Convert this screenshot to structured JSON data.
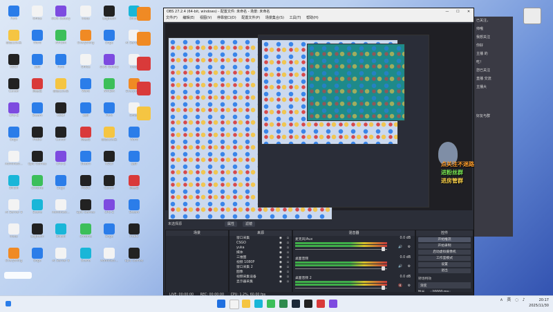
{
  "desktop": {
    "icons": [
      {
        "label": "Fork",
        "color": "tile-blue"
      },
      {
        "label": "新建文件夹",
        "color": "tile-folder"
      },
      {
        "label": "KODI",
        "color": "tile-dark"
      },
      {
        "label": "Cursor",
        "color": "tile-dark"
      },
      {
        "label": "CPU-Z",
        "color": "tile-purple"
      },
      {
        "label": "Edge",
        "color": "tile-blue"
      },
      {
        "label": "Administr...",
        "color": "tile-white"
      },
      {
        "label": "Bilibili",
        "color": "tile-cyan"
      },
      {
        "label": "AI Server 8",
        "color": "tile-white"
      },
      {
        "label": "Insta",
        "color": "tile-white"
      },
      {
        "label": "Everything",
        "color": "tile-orange"
      },
      {
        "label": "Office",
        "color": "tile-white"
      },
      {
        "label": "Word",
        "color": "tile-blue"
      },
      {
        "label": "录屏",
        "color": "tile-blue"
      },
      {
        "label": "网易云",
        "color": "tile-red"
      },
      {
        "label": "Steam",
        "color": "tile-blue"
      },
      {
        "label": "PUBG",
        "color": "tile-dark"
      },
      {
        "label": "Epic Games",
        "color": "tile-dark"
      },
      {
        "label": "Chrome",
        "color": "tile-green"
      },
      {
        "label": "Scene",
        "color": "tile-cyan"
      },
      {
        "label": "Logitech",
        "color": "tile-dark"
      },
      {
        "label": "Edge",
        "color": "tile-blue"
      },
      {
        "label": "GOG Galaxy",
        "color": "tile-purple"
      },
      {
        "label": "NVIDIA",
        "color": "tile-green"
      }
    ]
  },
  "obs": {
    "title": "OBS 27.2.4 (64-bit, windows) - 配置文件: 未命名 - 场景: 未命名",
    "menu": [
      "文件(F)",
      "编辑(E)",
      "视图(V)",
      "停靠窗口(D)",
      "配置文件(P)",
      "场景集合(S)",
      "工具(T)",
      "帮助(H)"
    ],
    "window_controls": {
      "minimize": "—",
      "maximize": "☐",
      "close": "✕"
    },
    "scene_bar": {
      "current": "未选择源",
      "properties": "属性",
      "filters": "滤镜"
    },
    "docks": {
      "scenes": {
        "title": "场景",
        "items": []
      },
      "sources": {
        "title": "来源",
        "items": [
          "窗口采集",
          "CSGO",
          "yuka",
          "媒体",
          "三维图",
          "视频 1080P",
          "窗口采集 2",
          "图像",
          "视频采集设备",
          "显示器采集"
        ]
      },
      "mixer": {
        "title": "混音器",
        "channels": [
          {
            "name": "麦克风/Aux",
            "db": "0.0 dB"
          },
          {
            "name": "桌面音频",
            "db": "0.0 dB"
          },
          {
            "name": "桌面音频 2",
            "db": "0.0 dB"
          }
        ]
      },
      "transitions": {
        "title": "转场特效",
        "type": "渐变",
        "duration_label": "时长",
        "duration": "20000 ms"
      },
      "controls": {
        "title": "控件",
        "buttons": [
          "开始推流",
          "开始录制",
          "启动虚拟摄像机",
          "工作室模式",
          "设置",
          "退出"
        ]
      }
    },
    "status": {
      "live": "LIVE: 00:00:00",
      "rec": "REC: 00:00:00",
      "cpu": "CPU: 1.2%, 60.00 fps"
    }
  },
  "chat": {
    "lines": [
      "已关注，",
      "帅哦",
      "我想关注",
      "你好",
      "主播 的",
      "吃！",
      "您已关注",
      "直播 交流",
      "主播大",
      "好友与群"
    ]
  },
  "overlay": {
    "line1": "点关注不迷路",
    "line2": "进粉丝群",
    "line3": "进房管群"
  },
  "taskbar": {
    "tray_lang": "英",
    "time": "20:17",
    "date": "2025/11/30"
  }
}
